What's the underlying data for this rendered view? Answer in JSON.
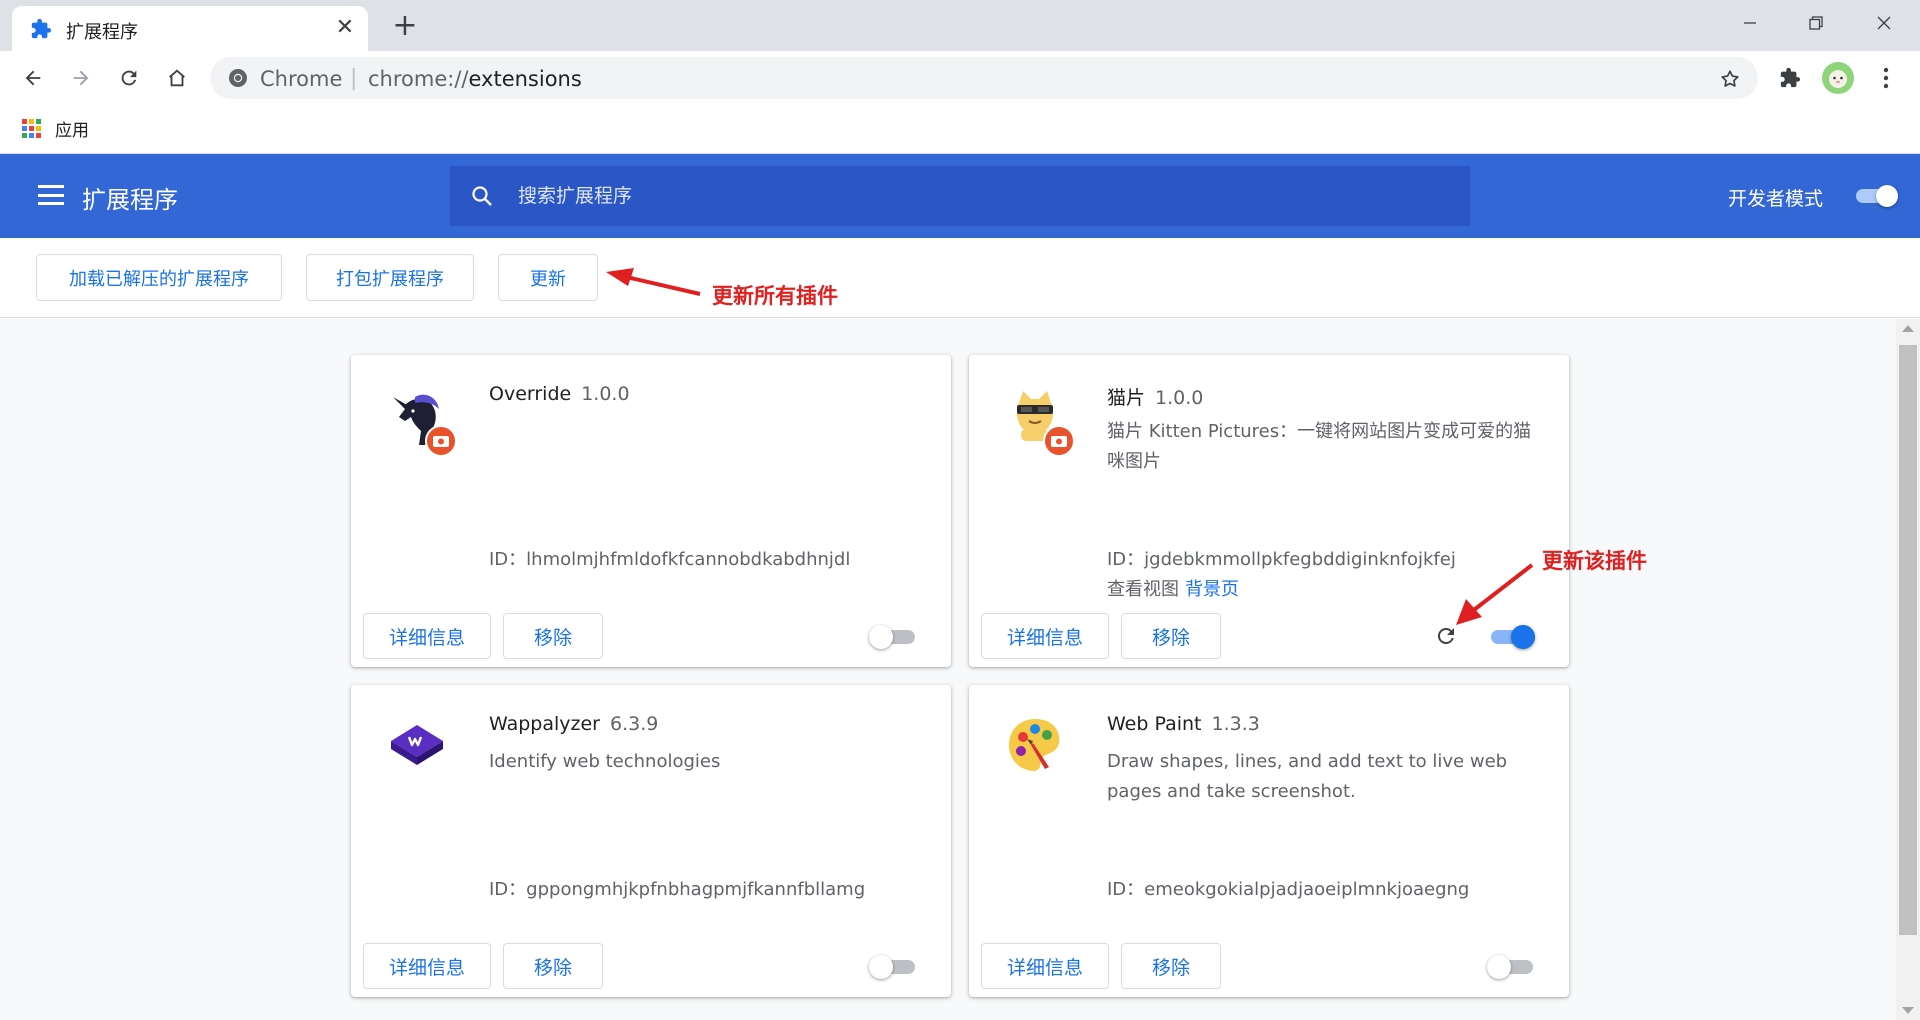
{
  "browser": {
    "tab": {
      "title": "扩展程序"
    },
    "omnibox": {
      "chip": "Chrome",
      "separator": "|",
      "url_prefix": "chrome://",
      "url_path": "extensions"
    }
  },
  "bookmarks": {
    "apps_label": "应用"
  },
  "header": {
    "title": "扩展程序",
    "search_placeholder": "搜索扩展程序",
    "dev_mode_label": "开发者模式",
    "dev_mode_on": true
  },
  "actions": {
    "load_unpacked": "加载已解压的扩展程序",
    "pack": "打包扩展程序",
    "update": "更新"
  },
  "annotations": {
    "update_all": "更新所有插件",
    "update_this": "更新该插件"
  },
  "card_labels": {
    "details": "详细信息",
    "remove": "移除",
    "inspect_views": "查看视图",
    "background_page": "背景页"
  },
  "extensions": [
    {
      "name": "Override",
      "version": "1.0.0",
      "description": "",
      "id": "ID：lhmolmjhfmldofkfcannobdkabdhnjdl",
      "enabled": false,
      "icon": "unicorn-icon",
      "badge": "unpacked-badge-icon"
    },
    {
      "name": "猫片",
      "version": "1.0.0",
      "description": "猫片 Kitten Pictures：一键将网站图片变成可爱的猫咪图片",
      "id": "ID：jgdebkmmollpkfegbddiginknfojkfej",
      "enabled": true,
      "icon": "kitten-icon",
      "badge": "unpacked-badge-icon"
    },
    {
      "name": "Wappalyzer",
      "version": "6.3.9",
      "description": "Identify web technologies",
      "id": "ID：gppongmhjkpfnbhagpmjfkannfbllamg",
      "enabled": false,
      "icon": "wappalyzer-icon"
    },
    {
      "name": "Web Paint",
      "version": "1.3.3",
      "description": "Draw shapes, lines, and add text to live web pages and take screenshot.",
      "id": "ID：emeokgokialpjadjaoeiplmnkjoaegng",
      "enabled": false,
      "icon": "web-paint-palette-icon"
    }
  ],
  "colors": {
    "header_blue": "#3367d6",
    "search_blue": "#2a56c6",
    "link_blue": "#1a73e8",
    "annotation_red": "#e02020",
    "badge_orange": "#e8532b"
  }
}
